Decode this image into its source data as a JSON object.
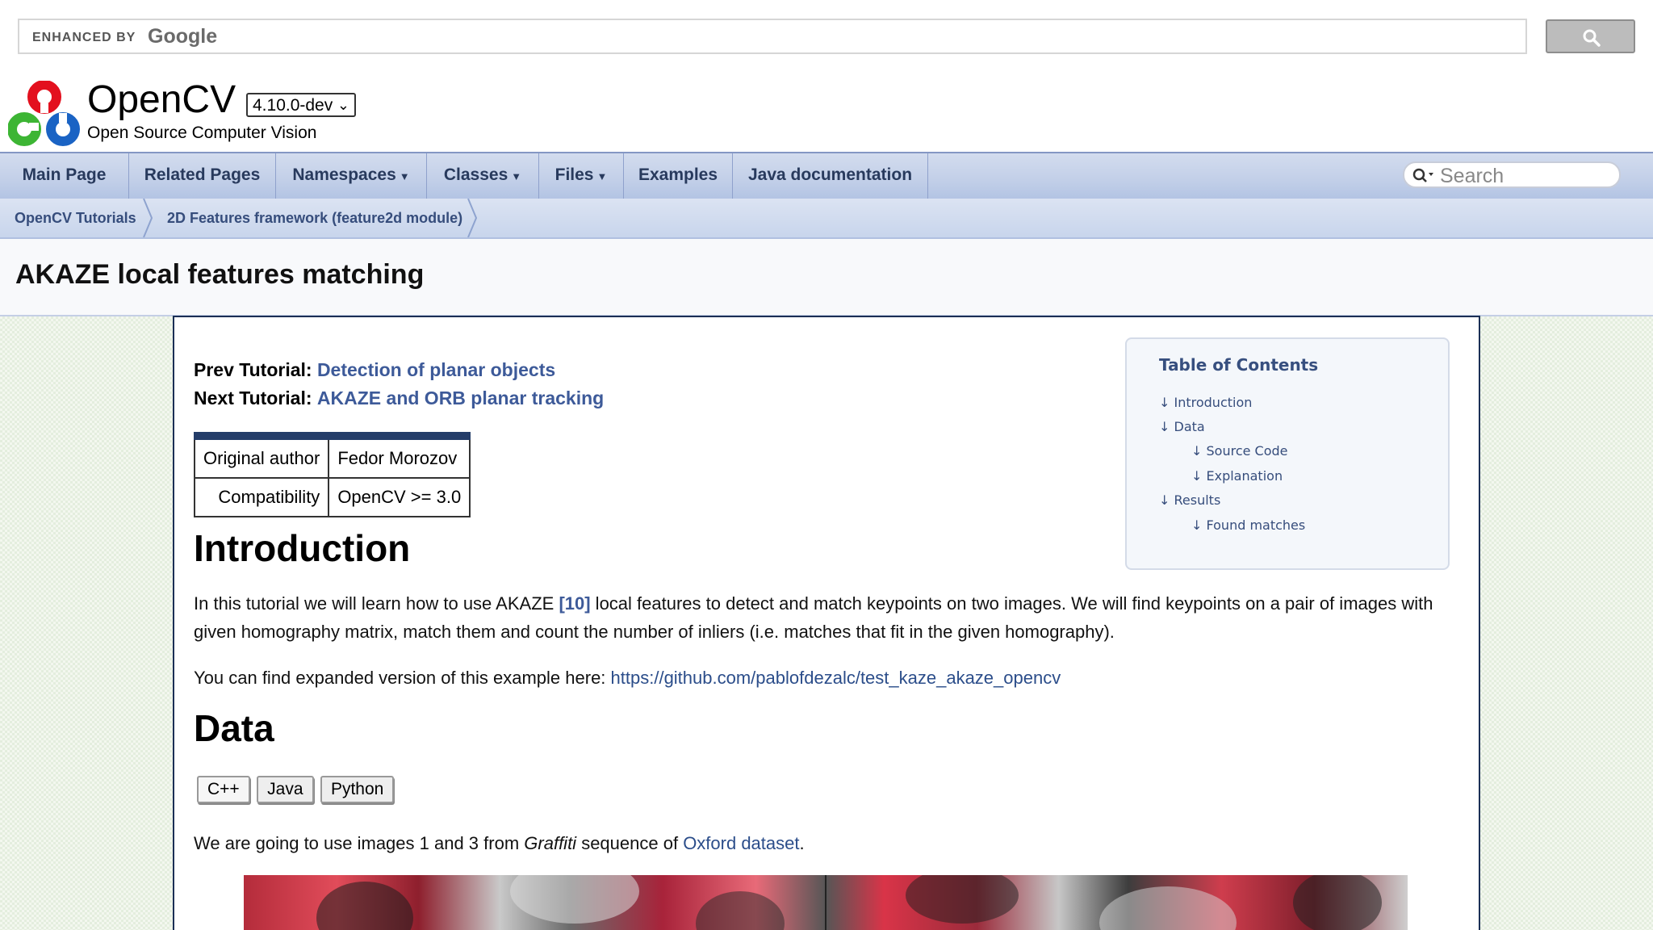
{
  "search": {
    "enhanced_by": "ENHANCED BY",
    "google": "Google"
  },
  "header": {
    "project_name": "OpenCV",
    "version": "4.10.0-dev",
    "brief": "Open Source Computer Vision"
  },
  "nav": {
    "items": [
      "Main Page",
      "Related Pages",
      "Namespaces",
      "Classes",
      "Files",
      "Examples",
      "Java documentation"
    ],
    "search_placeholder": "Search"
  },
  "breadcrumb": [
    "OpenCV Tutorials",
    "2D Features framework (feature2d module)"
  ],
  "page_title": "AKAZE local features matching",
  "content": {
    "prev_label": "Prev Tutorial:",
    "prev_link": "Detection of planar objects",
    "next_label": "Next Tutorial:",
    "next_link": "AKAZE and ORB planar tracking",
    "info_table": [
      {
        "key": "Original author",
        "value": "Fedor Morozov"
      },
      {
        "key": "Compatibility",
        "value": "OpenCV >= 3.0"
      }
    ],
    "intro_heading": "Introduction",
    "intro_p1_a": "In this tutorial we will learn how to use AKAZE ",
    "intro_cite": "[10]",
    "intro_p1_b": " local features to detect and match keypoints on two images. We will find keypoints on a pair of images with given homography matrix, match them and count the number of inliers (i.e. matches that fit in the given homography).",
    "intro_p2_a": "You can find expanded version of this example here: ",
    "intro_p2_link": "https://github.com/pablofdezalc/test_kaze_akaze_opencv",
    "data_heading": "Data",
    "code_tabs": [
      "C++",
      "Java",
      "Python"
    ],
    "data_p_a": "We are going to use images 1 and 3 from ",
    "data_p_em": "Graffiti",
    "data_p_b": " sequence of ",
    "data_p_link": "Oxford dataset",
    "data_p_c": "."
  },
  "toc": {
    "title": "Table of Contents",
    "entries": [
      {
        "label": "Introduction",
        "level": 1
      },
      {
        "label": "Data",
        "level": 1
      },
      {
        "label": "Source Code",
        "level": 2
      },
      {
        "label": "Explanation",
        "level": 2
      },
      {
        "label": "Results",
        "level": 1
      },
      {
        "label": "Found matches",
        "level": 2
      }
    ]
  },
  "colors": {
    "nav_text": "#283a5d",
    "link": "#2b4d8a",
    "content_border": "#1b2f55"
  }
}
